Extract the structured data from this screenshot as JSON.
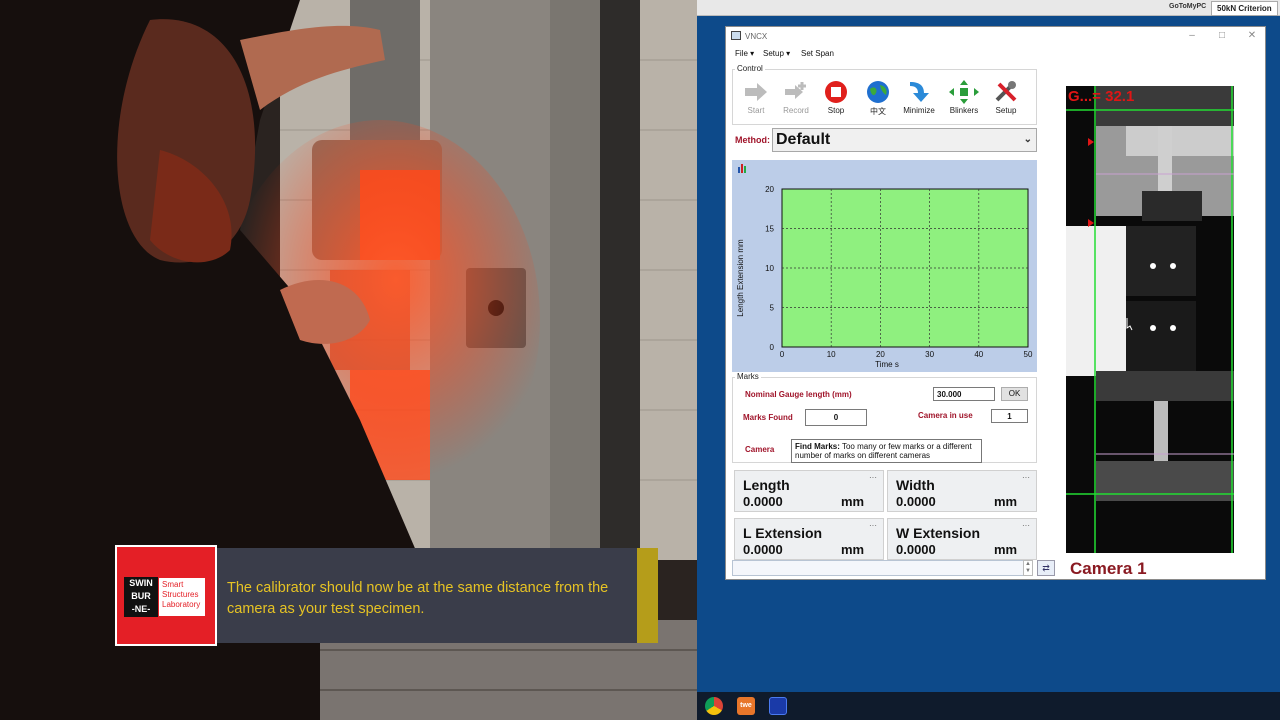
{
  "desktop": {
    "topstrip": {
      "goto_label": "GoToMyPC",
      "machine_label": "50kN Criterion"
    }
  },
  "window": {
    "title": "VNCX",
    "menu": [
      "File ▾",
      "Setup ▾",
      "Set Span"
    ],
    "control_group_label": "Control",
    "tools": [
      {
        "label": "Start",
        "icon": "play-arrow-icon",
        "enabled": false
      },
      {
        "label": "Record",
        "icon": "record-plus-icon",
        "enabled": false
      },
      {
        "label": "Stop",
        "icon": "stop-icon",
        "enabled": true
      },
      {
        "label": "中文",
        "icon": "globe-icon",
        "enabled": true
      },
      {
        "label": "Minimize",
        "icon": "minimize-arrow-icon",
        "enabled": true
      },
      {
        "label": "Blinkers",
        "icon": "blinkers-icon",
        "enabled": true
      },
      {
        "label": "Setup",
        "icon": "tools-icon",
        "enabled": true
      }
    ],
    "method": {
      "label": "Method:",
      "value": "Default"
    },
    "marks": {
      "group_label": "Marks",
      "nominal_label": "Nominal Gauge length (mm)",
      "nominal_value": "30.000",
      "ok_label": "OK",
      "found_label": "Marks Found",
      "found_value": "0",
      "camera_in_use_label": "Camera in use",
      "camera_in_use_value": "1",
      "camera_label": "Camera",
      "camera_message_bold": "Find Marks:",
      "camera_message": " Too many or few marks or a different number of marks on different cameras"
    },
    "readouts": [
      {
        "label": "Length",
        "value": "0.0000",
        "unit": "mm"
      },
      {
        "label": "Width",
        "value": "0.0000",
        "unit": "mm"
      },
      {
        "label": "L Extension",
        "value": "0.0000",
        "unit": "mm"
      },
      {
        "label": "W Extension",
        "value": "0.0000",
        "unit": "mm"
      }
    ],
    "camera": {
      "gauge_text": "G...= 32.1",
      "title": "Camera 1"
    }
  },
  "chart_data": {
    "type": "line",
    "xlabel": "Time s",
    "ylabel": "Length Extension mm",
    "xlim": [
      0,
      50
    ],
    "ylim": [
      0,
      20
    ],
    "x_ticks": [
      0,
      10,
      20,
      30,
      40,
      50
    ],
    "y_ticks": [
      0,
      5,
      10,
      15,
      20
    ],
    "grid": true,
    "series": [],
    "plot_color": "#8ff07f"
  },
  "caption": {
    "logo_swinburne": [
      "SWIN",
      "BUR",
      "-NE-"
    ],
    "logo_lab": [
      "Smart",
      "Structures",
      "Laboratory"
    ],
    "text": "The calibrator should now be at the same distance from the camera as your test specimen."
  },
  "colors": {
    "desktop_bg": "#0d4a8a",
    "accent_red": "#a0142a",
    "caption_text": "#e6c324",
    "brand_red": "#e41f26"
  }
}
